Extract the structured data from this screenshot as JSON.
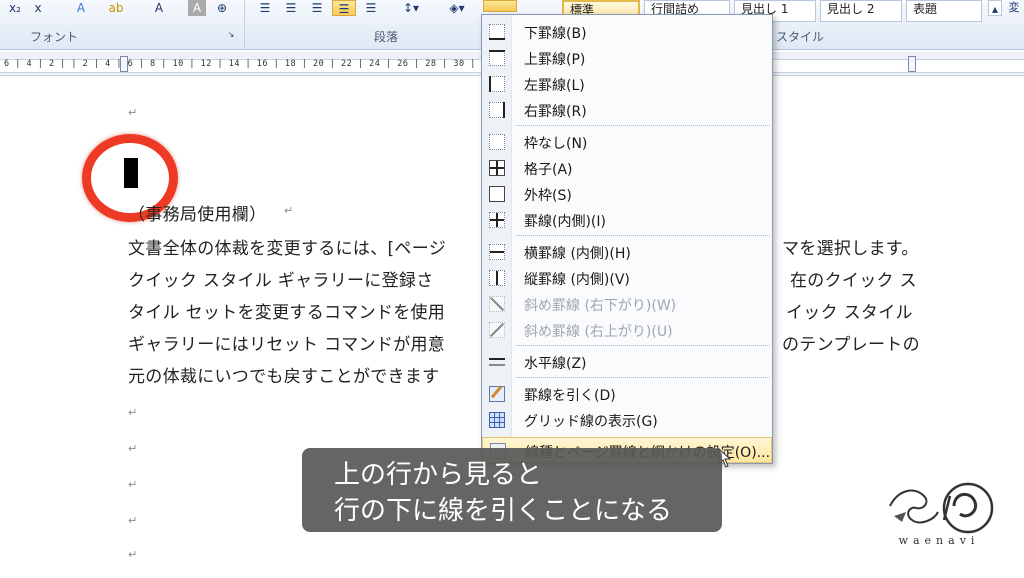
{
  "ribbon": {
    "font_group_label": "フォント",
    "paragraph_group_label": "段落",
    "style_group_label": "スタイル",
    "styles": [
      "標準",
      "行間詰め",
      "見出し 1",
      "見出し 2",
      "表題"
    ],
    "style_side": "変"
  },
  "ruler": {
    "text": "6 | 4 | 2 |    | 2 | 4 | 6 | 8 | 10 | 12 | 14 | 16 | 18 | 20 | 22 | 24 | 26 | 28 | 30 | 32 | 34 | 36 | 38 | 40 | 42 | 44 | 46"
  },
  "document": {
    "paragraph_mark": "↵",
    "heading": "（事務局使用欄）",
    "lines": [
      "文書全体の体裁を変更するには、[ページ",
      "クイック スタイル ギャラリーに登録さ",
      "タイル セットを変更するコマンドを使用",
      "ギャラリーにはリセット コマンドが用意",
      "元の体裁にいつでも戻すことができます"
    ],
    "lines_right": [
      "マを選択します。",
      "在のクイック ス",
      "イック スタイル",
      "のテンプレートの"
    ]
  },
  "menu": {
    "items": [
      {
        "label": "下罫線(B)",
        "icon": "border-bottom-icon",
        "disabled": false
      },
      {
        "label": "上罫線(P)",
        "icon": "border-top-icon",
        "disabled": false
      },
      {
        "label": "左罫線(L)",
        "icon": "border-left-icon",
        "disabled": false
      },
      {
        "label": "右罫線(R)",
        "icon": "border-right-icon",
        "disabled": false
      },
      {
        "label": "枠なし(N)",
        "icon": "no-border-icon",
        "disabled": false
      },
      {
        "label": "格子(A)",
        "icon": "all-borders-icon",
        "disabled": false
      },
      {
        "label": "外枠(S)",
        "icon": "outside-borders-icon",
        "disabled": false
      },
      {
        "label": "罫線(内側)(I)",
        "icon": "inside-borders-icon",
        "disabled": false
      },
      {
        "label": "横罫線 (内側)(H)",
        "icon": "inside-horizontal-icon",
        "disabled": false
      },
      {
        "label": "縦罫線 (内側)(V)",
        "icon": "inside-vertical-icon",
        "disabled": false
      },
      {
        "label": "斜め罫線 (右下がり)(W)",
        "icon": "diagonal-down-icon",
        "disabled": true
      },
      {
        "label": "斜め罫線 (右上がり)(U)",
        "icon": "diagonal-up-icon",
        "disabled": true
      },
      {
        "label": "水平線(Z)",
        "icon": "horizontal-line-icon",
        "disabled": false
      },
      {
        "label": "罫線を引く(D)",
        "icon": "draw-table-icon",
        "disabled": false
      },
      {
        "label": "グリッド線の表示(G)",
        "icon": "view-gridlines-icon",
        "disabled": false
      },
      {
        "label": "線種とページ罫線と網かけの設定(O)...",
        "icon": "borders-shading-icon",
        "disabled": false
      }
    ]
  },
  "caption": {
    "line1": "上の行から見ると",
    "line2": "行の下に線を引くことになる"
  },
  "logo": {
    "text": "waenavi"
  },
  "colors": {
    "ring": "#ee3a24",
    "accent": "#f7c95a"
  }
}
